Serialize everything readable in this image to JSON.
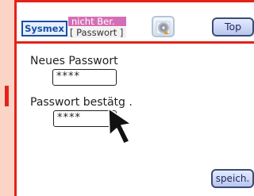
{
  "header": {
    "logo_text": "Sysmex",
    "status_text": "nicht Ber.",
    "screen_name": "[ Passwort ]",
    "top_button_label": "Top"
  },
  "form": {
    "new_password_label": "Neues Passwort",
    "new_password_value": "****",
    "confirm_password_label": "Passwort bestätg .",
    "confirm_password_value": "****"
  },
  "footer": {
    "save_button_label": "speich."
  },
  "icons": {
    "disc_button": "disc-icon",
    "pointer": "mouse-cursor-icon"
  },
  "colors": {
    "frame_red": "#e2231a",
    "status_magenta": "#d56fb5",
    "logo_blue": "#1a4fa3",
    "background_peach": "#fbd6c9"
  }
}
